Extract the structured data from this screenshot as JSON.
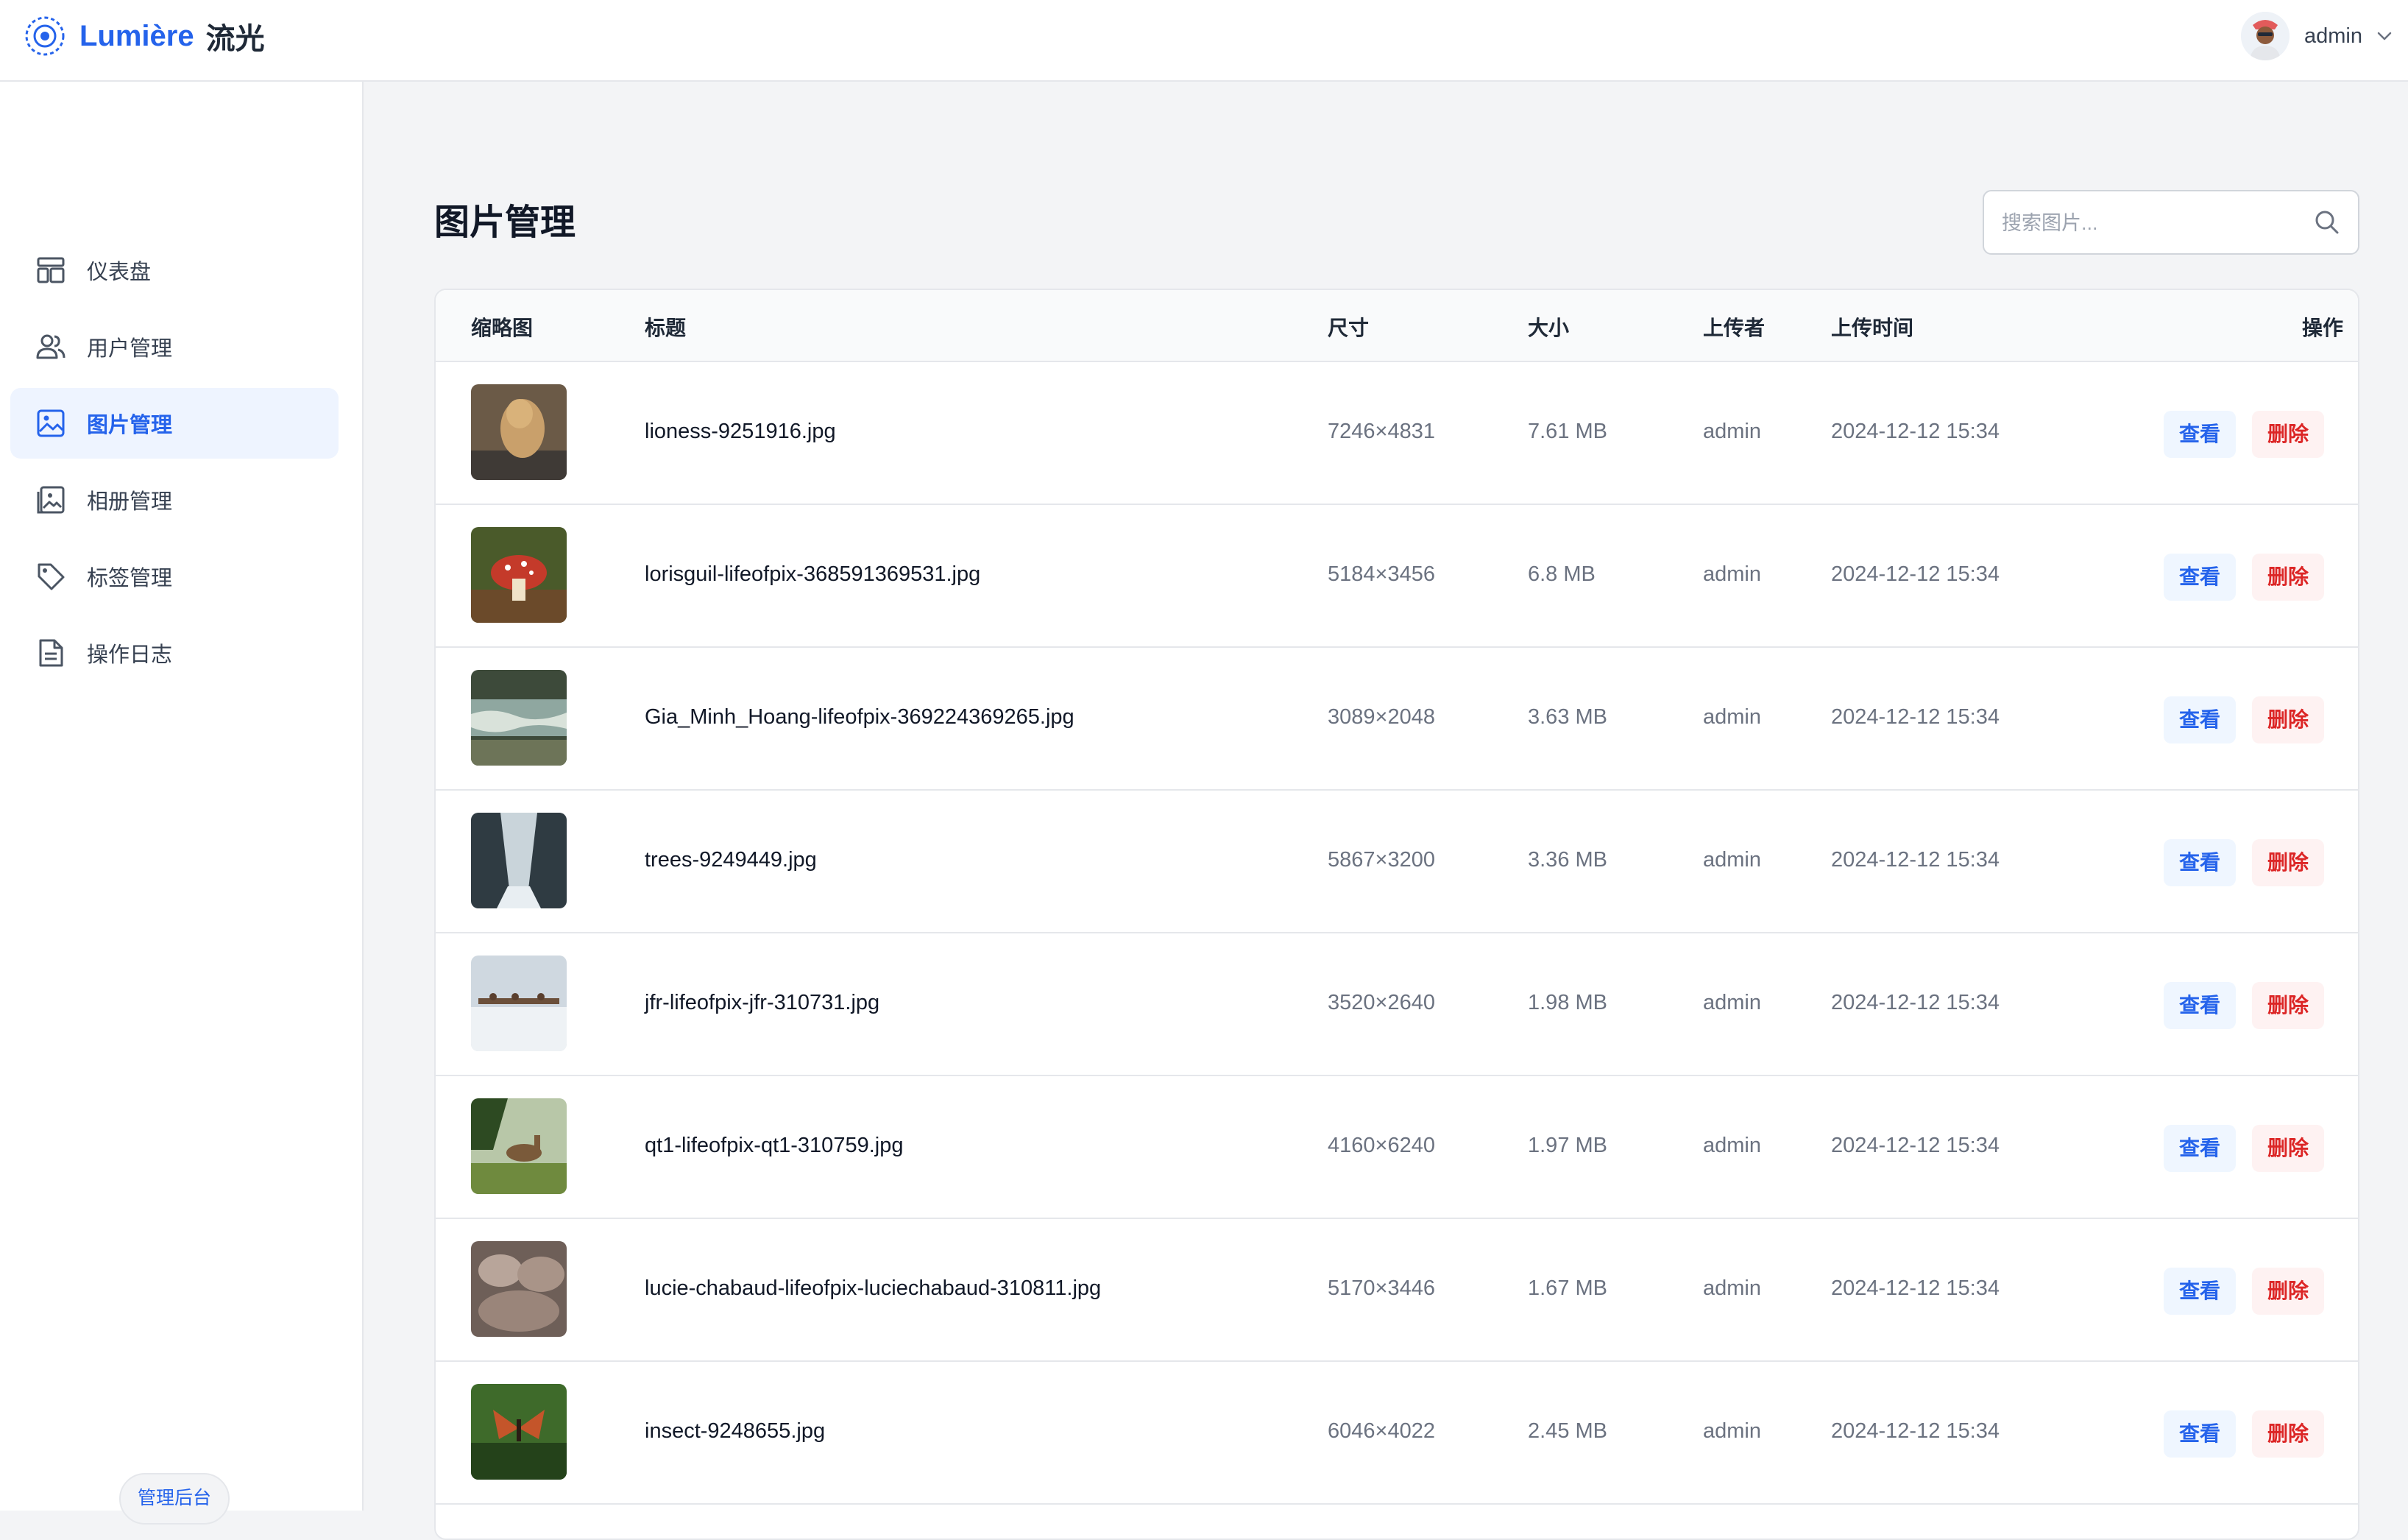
{
  "header": {
    "brand_name": "Lumière",
    "brand_cn": "流光",
    "user_name": "admin"
  },
  "sidebar": {
    "items": [
      {
        "label": "仪表盘",
        "icon": "dashboard-icon"
      },
      {
        "label": "用户管理",
        "icon": "users-icon"
      },
      {
        "label": "图片管理",
        "icon": "image-icon",
        "active": true
      },
      {
        "label": "相册管理",
        "icon": "album-icon"
      },
      {
        "label": "标签管理",
        "icon": "tag-icon"
      },
      {
        "label": "操作日志",
        "icon": "log-icon"
      }
    ],
    "admin_badge": "管理后台"
  },
  "main": {
    "title": "图片管理",
    "search_placeholder": "搜索图片..."
  },
  "table": {
    "columns": [
      "缩略图",
      "标题",
      "尺寸",
      "大小",
      "上传者",
      "上传时间",
      "操作"
    ],
    "view_label": "查看",
    "delete_label": "删除",
    "rows": [
      {
        "title": "lioness-9251916.jpg",
        "dims": "7246×4831",
        "size": "7.61 MB",
        "uploader": "admin",
        "time": "2024-12-12 15:34"
      },
      {
        "title": "lorisguil-lifeofpix-368591369531.jpg",
        "dims": "5184×3456",
        "size": "6.8 MB",
        "uploader": "admin",
        "time": "2024-12-12 15:34"
      },
      {
        "title": "Gia_Minh_Hoang-lifeofpix-369224369265.jpg",
        "dims": "3089×2048",
        "size": "3.63 MB",
        "uploader": "admin",
        "time": "2024-12-12 15:34"
      },
      {
        "title": "trees-9249449.jpg",
        "dims": "5867×3200",
        "size": "3.36 MB",
        "uploader": "admin",
        "time": "2024-12-12 15:34"
      },
      {
        "title": "jfr-lifeofpix-jfr-310731.jpg",
        "dims": "3520×2640",
        "size": "1.98 MB",
        "uploader": "admin",
        "time": "2024-12-12 15:34"
      },
      {
        "title": "qt1-lifeofpix-qt1-310759.jpg",
        "dims": "4160×6240",
        "size": "1.97 MB",
        "uploader": "admin",
        "time": "2024-12-12 15:34"
      },
      {
        "title": "lucie-chabaud-lifeofpix-luciechabaud-310811.jpg",
        "dims": "5170×3446",
        "size": "1.67 MB",
        "uploader": "admin",
        "time": "2024-12-12 15:34"
      },
      {
        "title": "insect-9248655.jpg",
        "dims": "6046×4022",
        "size": "2.45 MB",
        "uploader": "admin",
        "time": "2024-12-12 15:34"
      }
    ]
  },
  "colors": {
    "accent": "#2563eb",
    "danger": "#dc2626",
    "active_bg": "#eef4ff"
  }
}
